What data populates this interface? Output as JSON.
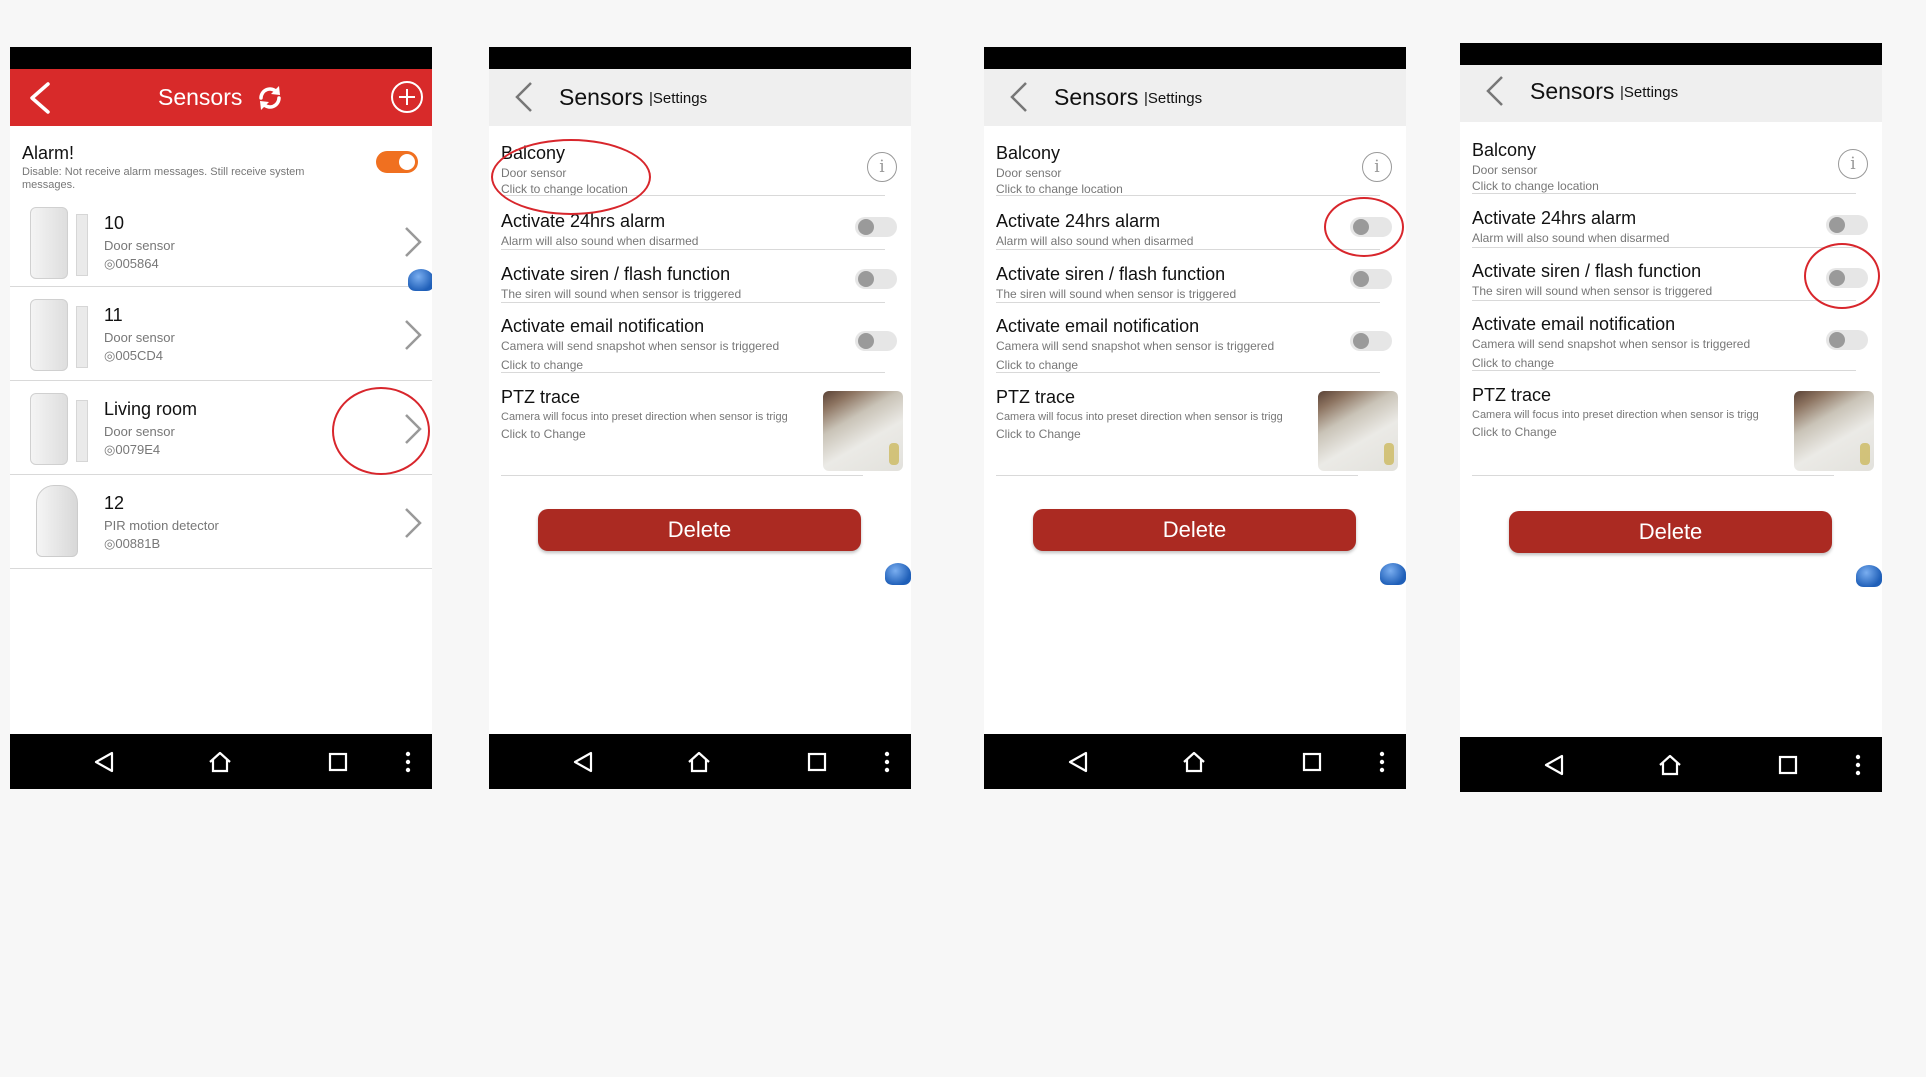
{
  "p1": {
    "title": "Sensors",
    "alarm": {
      "title": "Alarm!",
      "desc_line1": "Disable: Not receive alarm messages. Still receive system",
      "desc_line2": "messages."
    },
    "items": [
      {
        "name": "10",
        "type": "Door sensor",
        "id": "005864"
      },
      {
        "name": "11",
        "type": "Door sensor",
        "id": "005CD4"
      },
      {
        "name": "Living room",
        "type": "Door sensor",
        "id": "0079E4"
      },
      {
        "name": "12",
        "type": "PIR motion detector",
        "id": "00881B"
      }
    ]
  },
  "settings": {
    "title": "Sensors",
    "subtitle": "|Settings",
    "sensor_name": "Balcony",
    "sensor_type": "Door sensor",
    "location_hint": "Click to change location",
    "alarm24_title": "Activate 24hrs alarm",
    "alarm24_desc": "Alarm will also sound when disarmed",
    "siren_title": "Activate siren / flash function",
    "siren_desc": "The siren will sound when sensor is triggered",
    "email_title": "Activate email notification",
    "email_desc": "Camera will send snapshot when sensor is triggered",
    "email_hint": "Click to change",
    "ptz_title": "PTZ trace",
    "ptz_desc": "Camera will focus into preset direction when sensor is trigg",
    "ptz_hint": "Click to Change",
    "delete_label": "Delete"
  },
  "colors": {
    "header_red": "#d82a2a",
    "delete_red": "#ab2a22",
    "toggle_on": "#f07020",
    "annotation_red": "#d8262c"
  },
  "icons": [
    "back-arrow-icon",
    "refresh-icon",
    "add-circle-icon",
    "info-icon",
    "chevron-right-icon",
    "nav-back-icon",
    "nav-home-icon",
    "nav-recents-icon",
    "nav-menu-icon"
  ]
}
